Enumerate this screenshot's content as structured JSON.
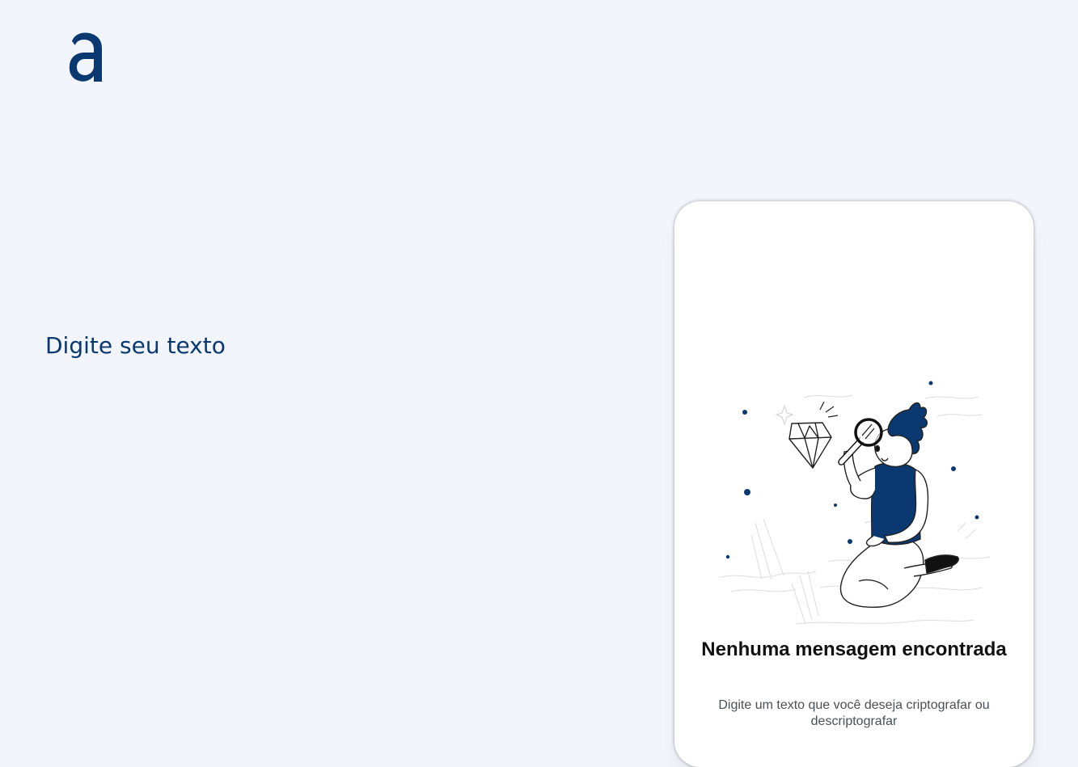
{
  "header": {
    "logo_icon": "alura-a-logo-icon"
  },
  "main": {
    "input": {
      "placeholder": "Digite seu texto"
    }
  },
  "output": {
    "illustration": "person-searching-diamond-illustration",
    "title": "Nenhuma mensagem encontrada",
    "text": "Digite um texto que você deseja criptografar ou descriptografar"
  },
  "colors": {
    "background": "#f3f5fc",
    "brand": "#0a3871",
    "card": "#ffffff",
    "title": "#111111",
    "text": "#495057"
  }
}
